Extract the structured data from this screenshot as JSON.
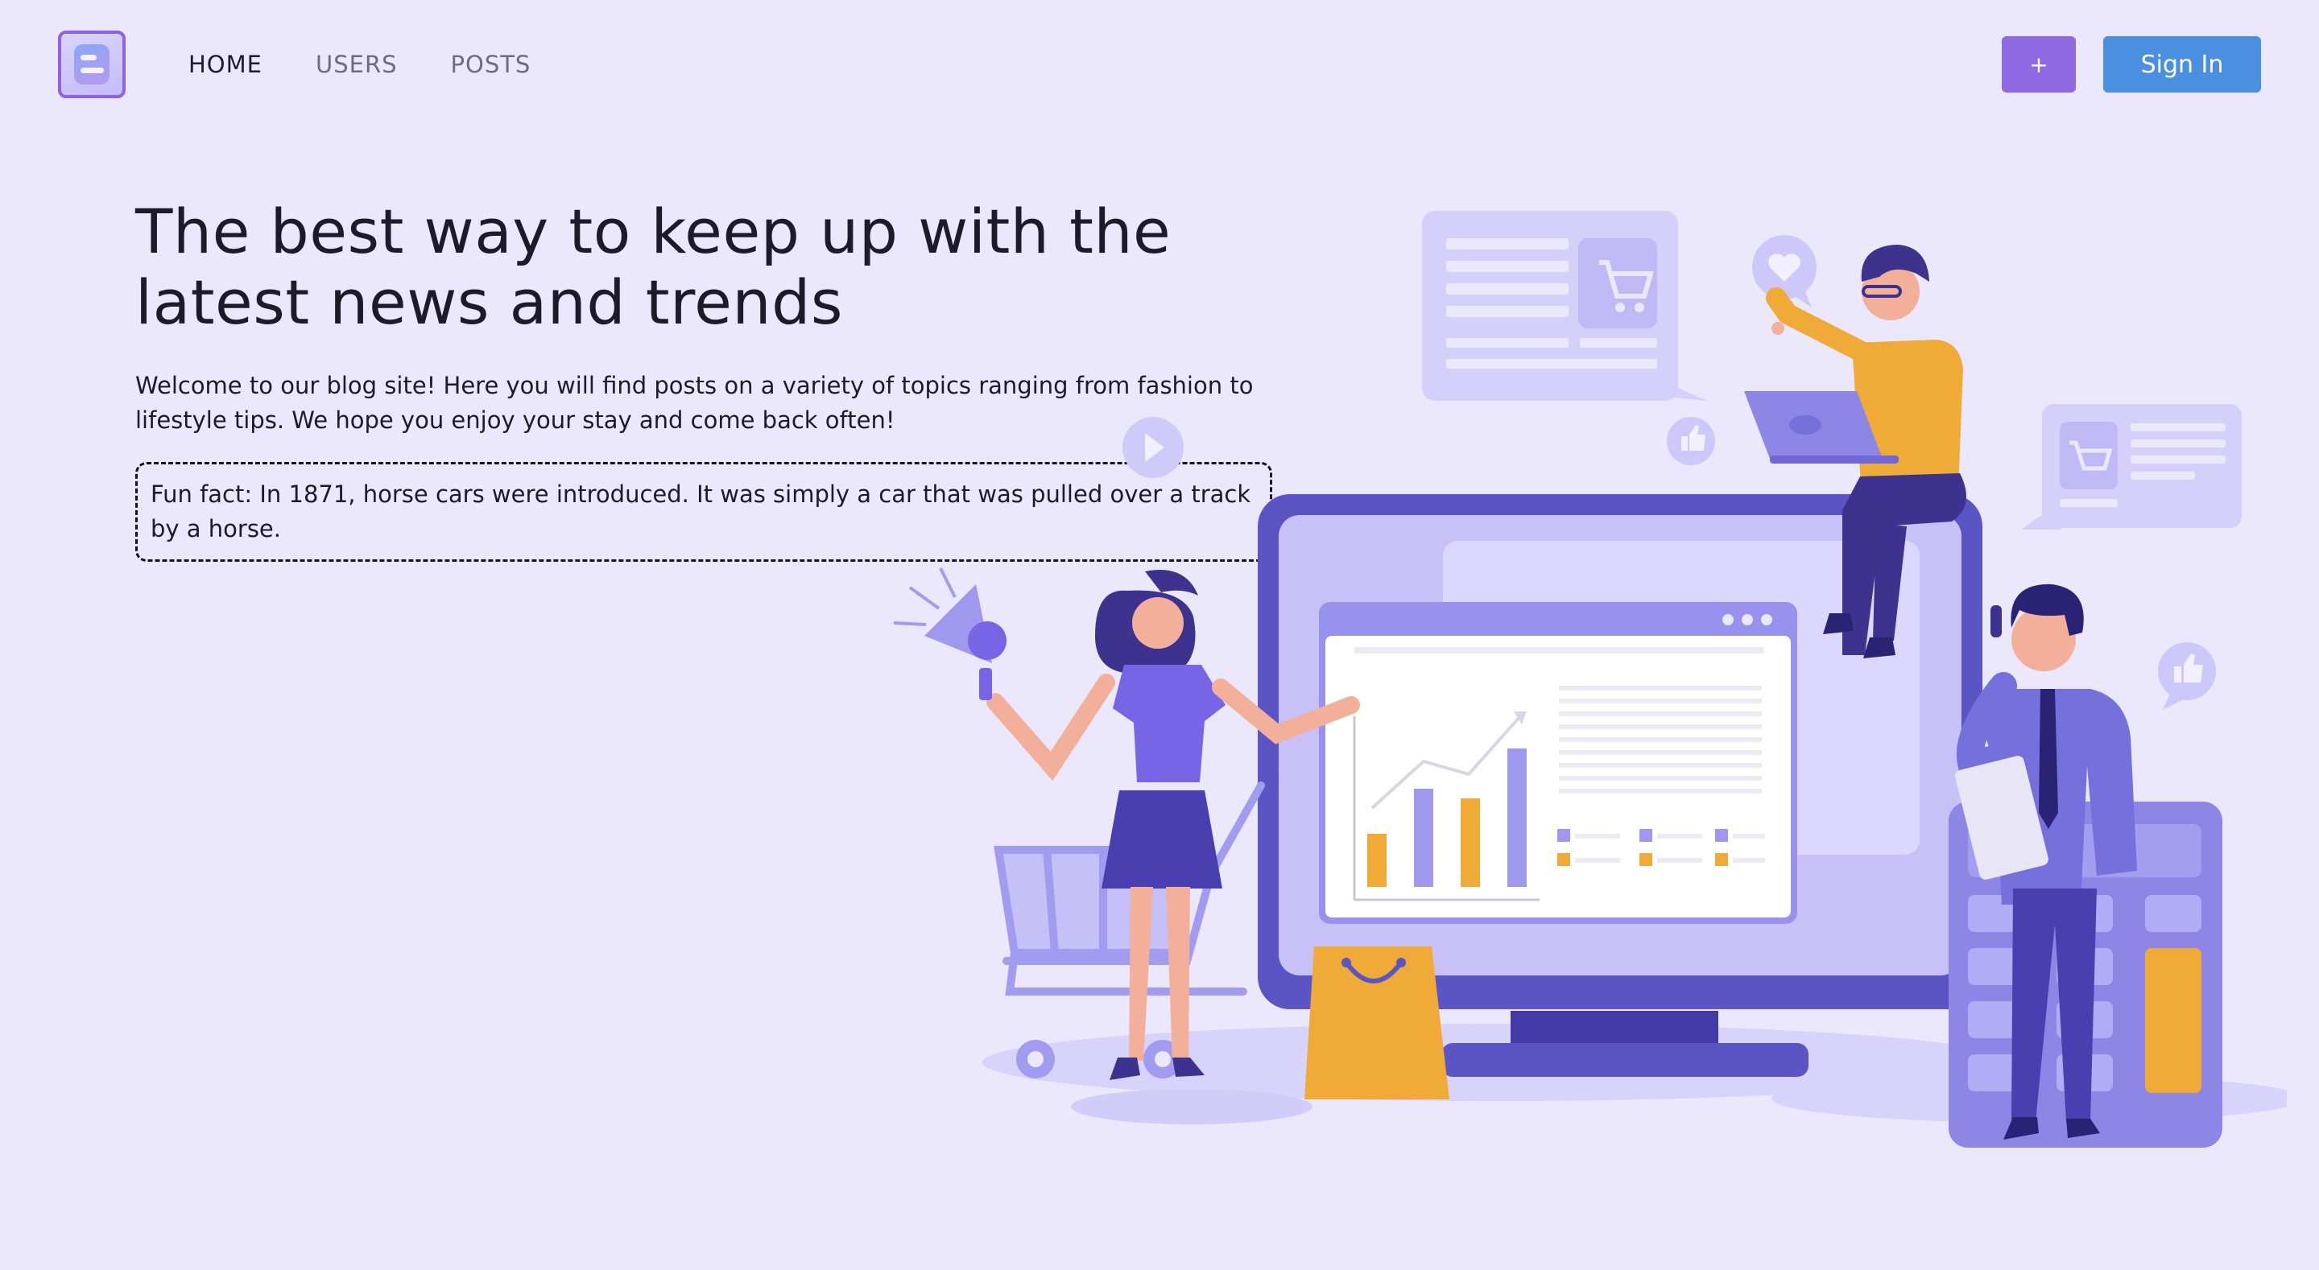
{
  "nav": {
    "logo_icon": "blogger-logo-icon",
    "links": [
      {
        "label": "HOME",
        "active": true
      },
      {
        "label": "USERS",
        "active": false
      },
      {
        "label": "POSTS",
        "active": false
      }
    ],
    "plus_label": "+",
    "signin_label": "Sign In"
  },
  "hero": {
    "title": "The best way to keep up with the latest news and trends",
    "subtitle": "Welcome to our blog site! Here you will find posts on a variety of topics ranging from fashion to lifestyle tips. We hope you enjoy your stay and come back often!",
    "fun_fact": "Fun fact: In 1871, horse cars were introduced. It was simply a car that was pulled over a track by a horse."
  },
  "colors": {
    "background": "#ebe7fd",
    "accent_purple": "#8f69e3",
    "accent_blue": "#4a8fe0",
    "illustration_indigo": "#5b54c4",
    "illustration_orange": "#f0aa37"
  }
}
